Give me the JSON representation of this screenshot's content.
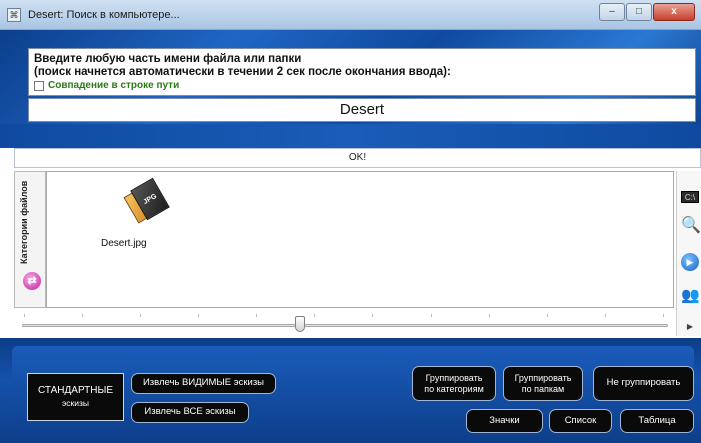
{
  "window": {
    "title": "Desert: Поиск в компьютере...",
    "minimize_glyph": "–",
    "maximize_glyph": "□",
    "close_glyph": "x"
  },
  "search": {
    "instruction_line1": "Введите любую часть имени файла или папки",
    "instruction_line2": "(поиск начнется автоматически в течении 2 сек после окончания ввода):",
    "path_match_label": "Совпадение в строке пути",
    "path_match_checked": false,
    "query": "Desert"
  },
  "status": {
    "text": "OK!"
  },
  "categories_tab": {
    "label": "Категории файлов",
    "icon": "swap-arrows-icon"
  },
  "results": {
    "items": [
      {
        "name": "Desert.jpg",
        "badge": "JPG",
        "icon": "jpg-file-icon"
      }
    ]
  },
  "right_toolbar": {
    "icons": [
      "console-icon",
      "search-folder-icon",
      "play-icon",
      "users-icon",
      "arrow-right-icon"
    ]
  },
  "thumbnail_slider": {
    "value_fraction": 0.43
  },
  "bottom_toolbar": {
    "standard_thumbs_line1": "СТАНДАРТНЫЕ",
    "standard_thumbs_line2": "эскизы",
    "extract_visible": "Извлечь ВИДИМЫЕ эскизы",
    "extract_all": "Извлечь ВСЕ эскизы",
    "group_by_category_line1": "Группировать",
    "group_by_category_line2": "по категориям",
    "group_by_folder_line1": "Группировать",
    "group_by_folder_line2": "по папкам",
    "no_grouping": "Не группировать",
    "view_icons": "Значки",
    "view_list": "Список",
    "view_table": "Таблица"
  },
  "colors": {
    "frame_blue": "#1552aa",
    "button_black": "#0a0a0a",
    "checkbox_label_green": "#2a7a1a"
  }
}
